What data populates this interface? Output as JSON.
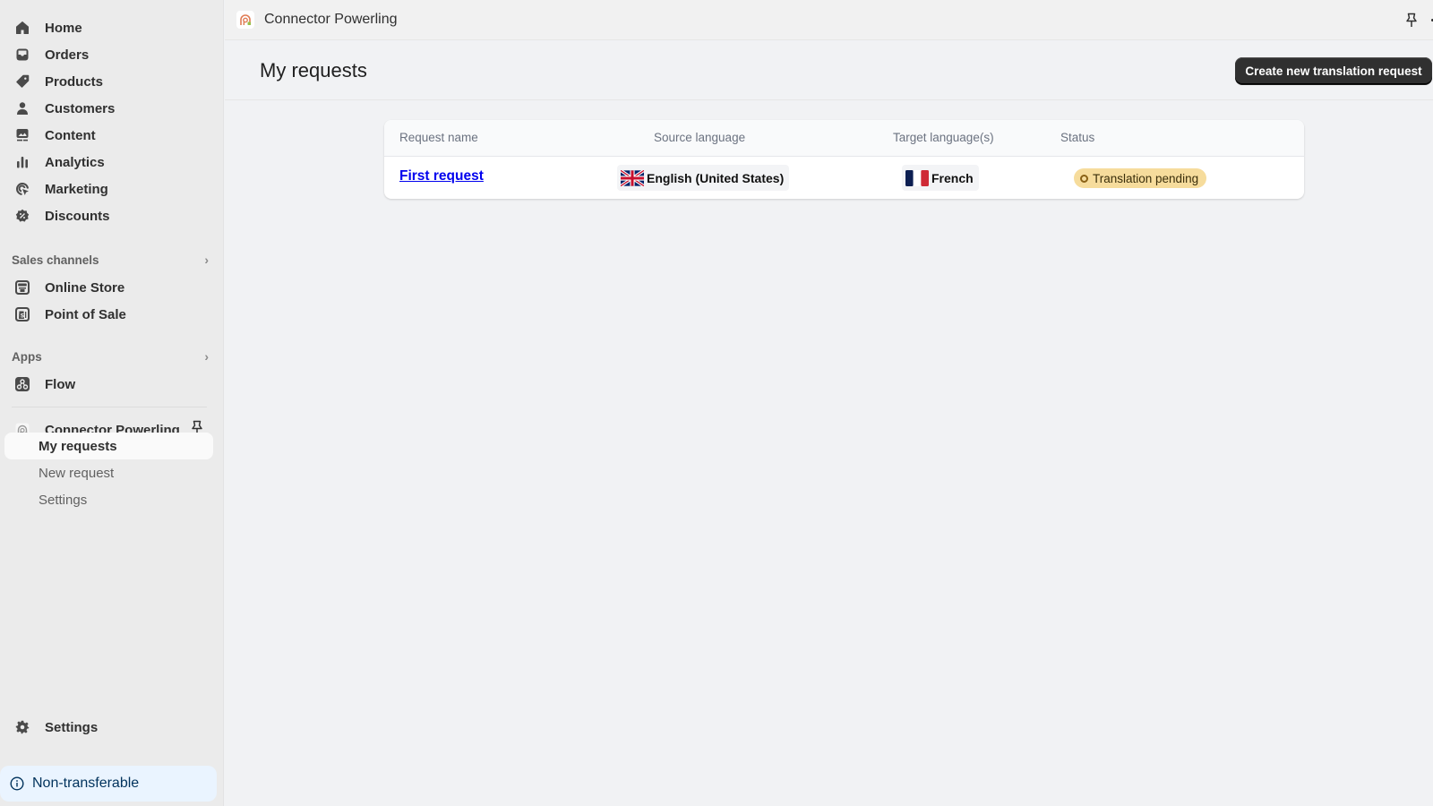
{
  "sidebar": {
    "main_nav": [
      {
        "label": "Home",
        "icon": "home-icon"
      },
      {
        "label": "Orders",
        "icon": "inbox-icon"
      },
      {
        "label": "Products",
        "icon": "tag-icon"
      },
      {
        "label": "Customers",
        "icon": "person-icon"
      },
      {
        "label": "Content",
        "icon": "image-icon"
      },
      {
        "label": "Analytics",
        "icon": "bar-chart-icon"
      },
      {
        "label": "Marketing",
        "icon": "target-icon"
      },
      {
        "label": "Discounts",
        "icon": "discount-icon"
      }
    ],
    "sales_channels": {
      "heading": "Sales channels",
      "items": [
        {
          "label": "Online Store",
          "icon": "store-icon"
        },
        {
          "label": "Point of Sale",
          "icon": "pos-icon"
        }
      ]
    },
    "apps": {
      "heading": "Apps",
      "items": [
        {
          "label": "Flow",
          "icon": "flow-icon"
        }
      ]
    },
    "current_app": {
      "label": "Connector Powerling",
      "sub_items": [
        {
          "label": "My requests",
          "active": true
        },
        {
          "label": "New request",
          "active": false
        },
        {
          "label": "Settings",
          "active": false
        }
      ]
    },
    "settings_label": "Settings",
    "banner_label": "Non-transferable"
  },
  "topbar": {
    "app_title": "Connector Powerling"
  },
  "page": {
    "title": "My requests",
    "create_button_label": "Create new translation request"
  },
  "table": {
    "headers": [
      "Request name",
      "Source language",
      "Target language(s)",
      "Status"
    ],
    "rows": [
      {
        "request_name": "First request",
        "source_language": "English (United States)",
        "source_flag": "uk-flag",
        "target_language": "French",
        "target_flag": "france-flag",
        "status": "Translation pending"
      }
    ]
  },
  "colors": {
    "sidebar_bg": "#ebebeb",
    "main_bg": "#f1f2f4",
    "primary_button": "#303030",
    "status_pending_bg": "#f6dc9c",
    "banner_bg": "#eaf4ff",
    "link": "#0000ee"
  }
}
